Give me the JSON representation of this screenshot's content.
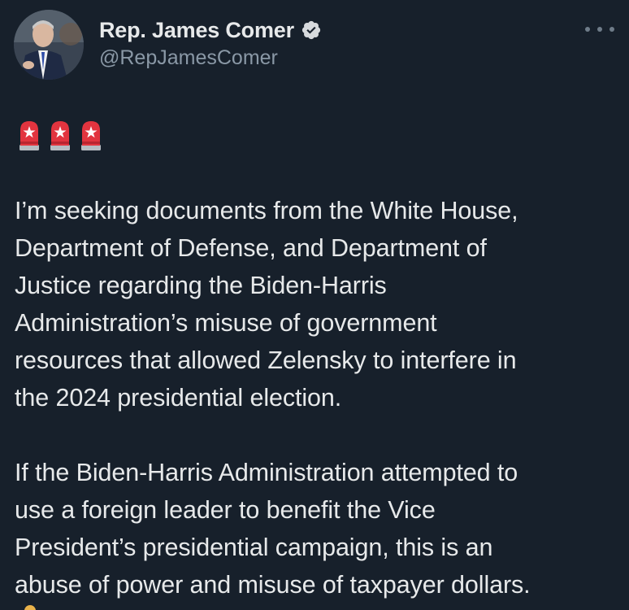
{
  "post": {
    "author": {
      "display_name": "Rep. James Comer",
      "handle": "@RepJamesComer",
      "verified": true,
      "verified_color": "#d7dadd"
    },
    "emoji": [
      "rotating-light",
      "rotating-light",
      "rotating-light"
    ],
    "paragraphs": [
      {
        "lines": [
          "I’m seeking documents from the White House,",
          "Department of Defense, and Department of",
          "Justice regarding the Biden-Harris",
          "Administration’s misuse of government",
          "resources that allowed Zelensky to interfere in",
          "the 2024 presidential election."
        ]
      },
      {
        "lines": [
          "If the Biden-Harris Administration attempted to",
          "use a foreign leader to benefit the Vice",
          "President’s presidential campaign, this is an",
          "abuse of power and misuse of taxpayer dollars."
        ]
      }
    ]
  },
  "colors": {
    "background": "#17202b",
    "text": "#e7e9ea",
    "secondary_text": "#8a98a6"
  }
}
